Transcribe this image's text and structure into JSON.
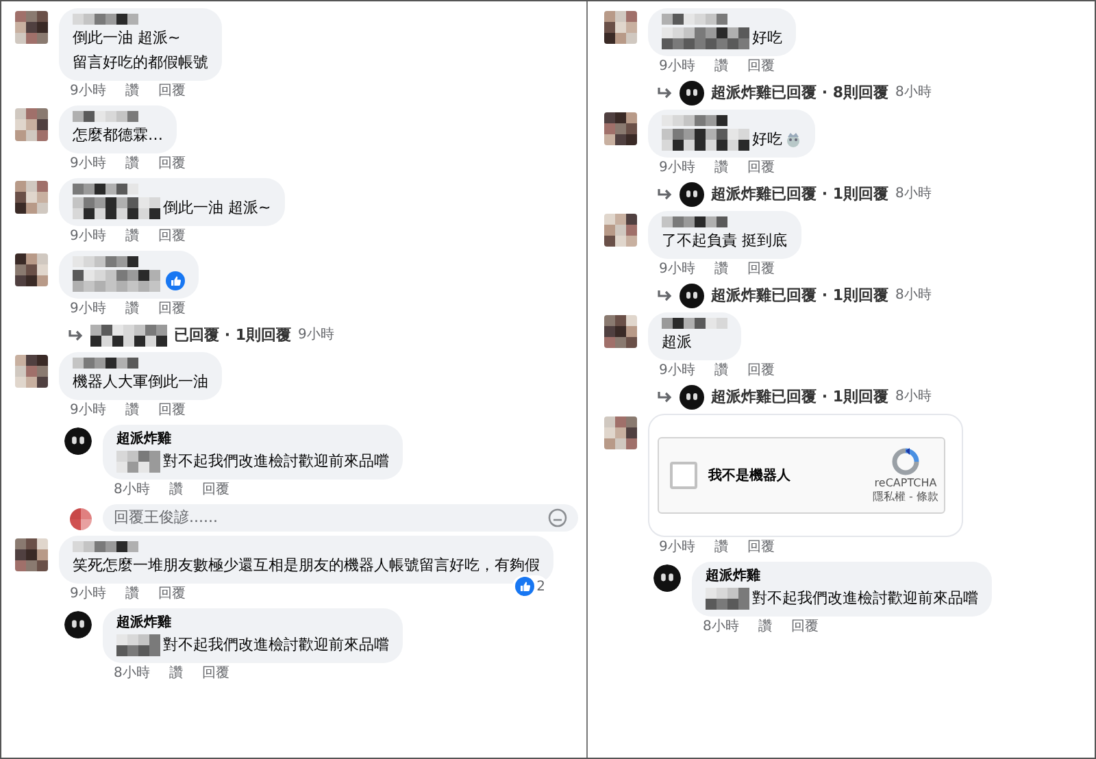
{
  "panels": [
    {
      "items": [
        {
          "kind": "comment",
          "blurred_prefix": false,
          "lines": [
            "倒此一油 超派~",
            "留言好吃的都假帳號"
          ],
          "meta": [
            "9小時",
            "讚",
            "回覆"
          ]
        },
        {
          "kind": "comment",
          "blurred_prefix": false,
          "lines": [
            "怎麼都德霖…"
          ],
          "meta": [
            "9小時",
            "讚",
            "回覆"
          ]
        },
        {
          "kind": "comment",
          "blurred_prefix": true,
          "lines": [
            "倒此一油 超派~"
          ],
          "meta": [
            "9小時",
            "讚",
            "回覆"
          ]
        },
        {
          "kind": "comment",
          "blurred_prefix": true,
          "reaction": true,
          "meta": [
            "9小時",
            "讚",
            "回覆"
          ]
        },
        {
          "kind": "summary",
          "page_avatar": false,
          "text": "已回覆 · 1則回覆",
          "time": "9小時"
        },
        {
          "kind": "comment",
          "blurred_prefix": false,
          "lines": [
            "機器人大軍倒此一油"
          ],
          "meta": [
            "9小時",
            "讚",
            "回覆"
          ]
        },
        {
          "kind": "reply",
          "name": "超派炸雞",
          "blurred_prefix": true,
          "text": "對不起我們改進檢討歡迎前來品嚐",
          "meta": [
            "8小時",
            "讚",
            "回覆"
          ]
        },
        {
          "kind": "input",
          "placeholder": "回覆王俊諺......"
        },
        {
          "kind": "comment",
          "blurred_prefix": false,
          "lines": [
            "笑死怎麼一堆朋友數極少還互相是朋友的機器人帳號留言好吃，有夠假"
          ],
          "reaction": true,
          "reaction_count": "2",
          "meta": [
            "9小時",
            "讚",
            "回覆"
          ]
        },
        {
          "kind": "reply",
          "name": "超派炸雞",
          "blurred_prefix": true,
          "text": "對不起我們改進檢討歡迎前來品嚐",
          "meta": [
            "8小時",
            "讚",
            "回覆"
          ]
        }
      ]
    },
    {
      "items": [
        {
          "kind": "comment",
          "blurred_prefix": true,
          "lines": [
            "好吃"
          ],
          "meta": [
            "9小時",
            "讚",
            "回覆"
          ]
        },
        {
          "kind": "summary",
          "page_avatar": true,
          "text": "超派炸雞已回覆 · 8則回覆",
          "time": "8小時"
        },
        {
          "kind": "comment",
          "blurred_prefix": true,
          "lines": [
            "好吃"
          ],
          "emoji": true,
          "meta": [
            "9小時",
            "讚",
            "回覆"
          ]
        },
        {
          "kind": "summary",
          "page_avatar": true,
          "text": "超派炸雞已回覆 · 1則回覆",
          "time": "8小時"
        },
        {
          "kind": "comment",
          "blurred_prefix": false,
          "lines": [
            "了不起負責 挺到底"
          ],
          "meta": [
            "9小時",
            "讚",
            "回覆"
          ]
        },
        {
          "kind": "summary",
          "page_avatar": true,
          "text": "超派炸雞已回覆 · 1則回覆",
          "time": "8小時"
        },
        {
          "kind": "comment",
          "blurred_prefix": false,
          "lines": [
            "超派"
          ],
          "meta": [
            "9小時",
            "讚",
            "回覆"
          ]
        },
        {
          "kind": "summary",
          "page_avatar": true,
          "text": "超派炸雞已回覆 · 1則回覆",
          "time": "8小時"
        },
        {
          "kind": "comment",
          "blurred_prefix": false,
          "captcha": {
            "label": "我不是機器人",
            "checked": false,
            "brand": "reCAPTCHA",
            "links": "隱私權 - 條款"
          },
          "meta": [
            "9小時",
            "讚",
            "回覆"
          ]
        },
        {
          "kind": "reply",
          "name": "超派炸雞",
          "blurred_prefix": true,
          "text": "對不起我們改進檢討歡迎前來品嚐",
          "meta": [
            "8小時",
            "讚",
            "回覆"
          ]
        }
      ]
    }
  ]
}
